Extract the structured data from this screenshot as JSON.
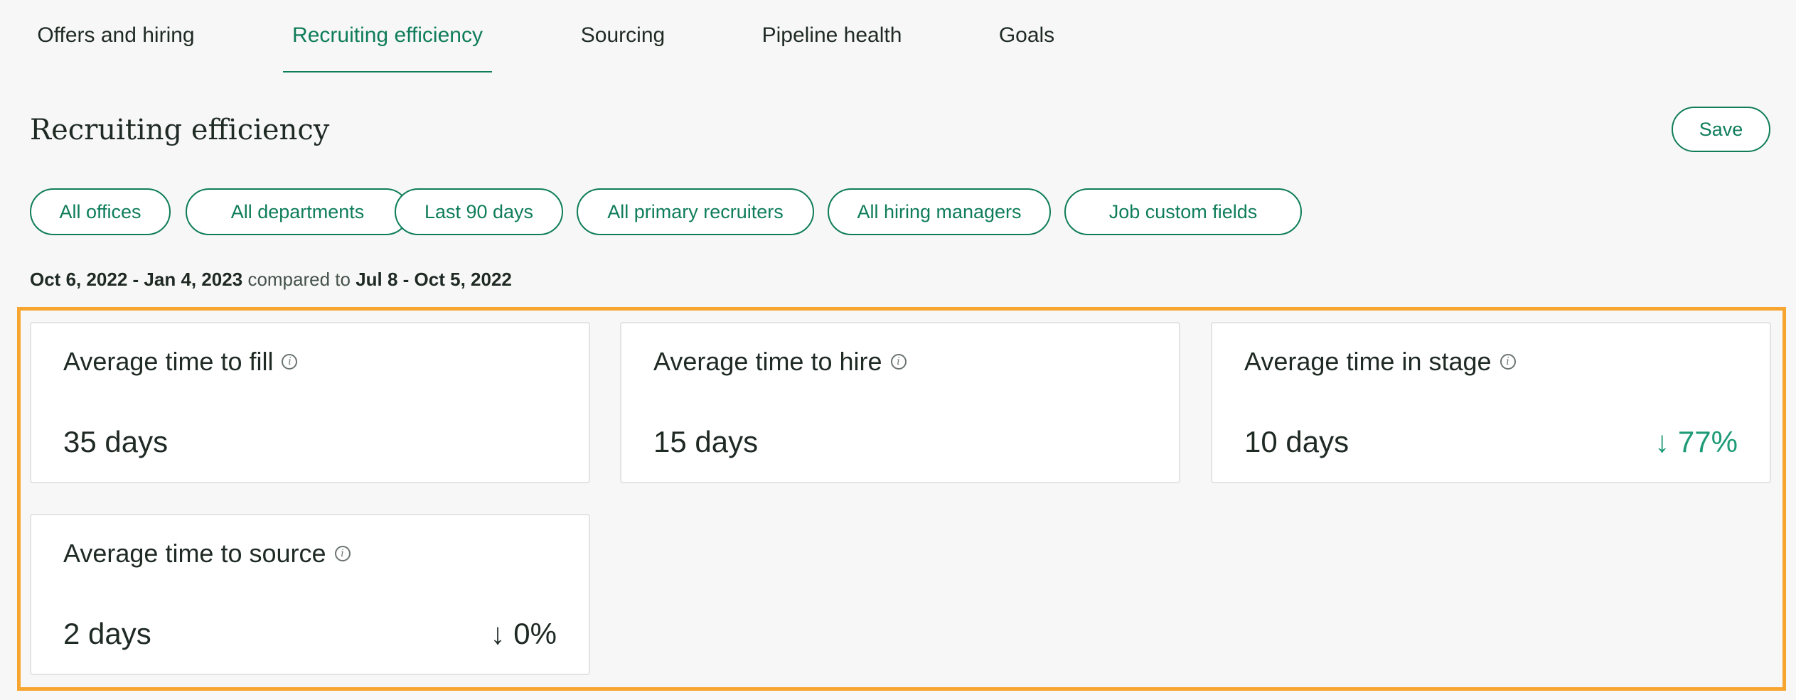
{
  "tabs": [
    {
      "label": "Offers and hiring"
    },
    {
      "label": "Recruiting efficiency"
    },
    {
      "label": "Sourcing"
    },
    {
      "label": "Pipeline health"
    },
    {
      "label": "Goals"
    }
  ],
  "header": {
    "title": "Recruiting efficiency",
    "save_label": "Save"
  },
  "filters": [
    {
      "label": "All offices"
    },
    {
      "label": "All departments"
    },
    {
      "label": "Last 90 days"
    },
    {
      "label": "All primary recruiters"
    },
    {
      "label": "All hiring managers"
    },
    {
      "label": "Job custom fields"
    }
  ],
  "date_range": {
    "current": "Oct 6, 2022 - Jan 4, 2023",
    "connector": "compared to",
    "previous": "Jul 8 - Oct 5, 2022"
  },
  "cards": [
    {
      "title": "Average time to fill",
      "value": "35 days",
      "change": ""
    },
    {
      "title": "Average time to hire",
      "value": "15 days",
      "change": ""
    },
    {
      "title": "Average time in stage",
      "value": "10 days",
      "change": "↓ 77%"
    },
    {
      "title": "Average time to source",
      "value": "2 days",
      "change": "↓ 0%"
    }
  ],
  "colors": {
    "accent": "#0f7d5a",
    "positive_change": "#1f9b77",
    "highlight": "#f7a531",
    "background": "#f7f7f7"
  },
  "icons": {
    "info": "info-icon"
  }
}
